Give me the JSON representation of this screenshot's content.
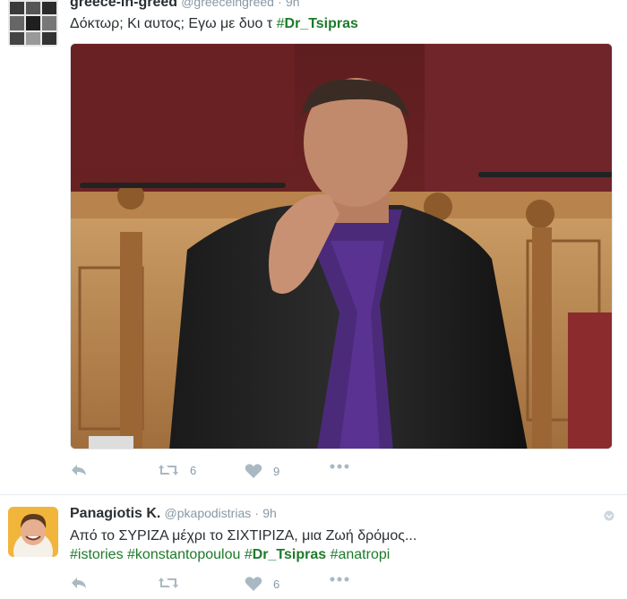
{
  "tweets": [
    {
      "name": "greece-in-greed",
      "handle": "@greeceingreed",
      "separator": "·",
      "time": "9h",
      "text_plain": "Δόκτωρ; Κι αυτος; Εγω με δυο τ ",
      "hashtags": [
        "#Dr_Tsipras"
      ],
      "has_media": true,
      "actions": {
        "retweets": "6",
        "likes": "9"
      },
      "colors": {
        "hashtag": "#1d7a2a",
        "muted": "#8899a6"
      }
    },
    {
      "name": "Panagiotis K.",
      "handle": "@pkapodistrias",
      "separator": "·",
      "time": "9h",
      "line1": "Από το ΣΥΡΙΖΑ μέχρι το ΣΙΧΤΙΡΙΖΑ, μια Ζωή δρόμος...",
      "line2_tags": [
        "#istories",
        "#konstantopoulou",
        "#Dr_Tsipras",
        "#anatropi"
      ],
      "actions": {
        "retweets": "",
        "likes": "6"
      }
    }
  ],
  "icons": [
    "reply-icon",
    "retweet-icon",
    "like-icon",
    "more-icon",
    "chevron-down-icon"
  ]
}
